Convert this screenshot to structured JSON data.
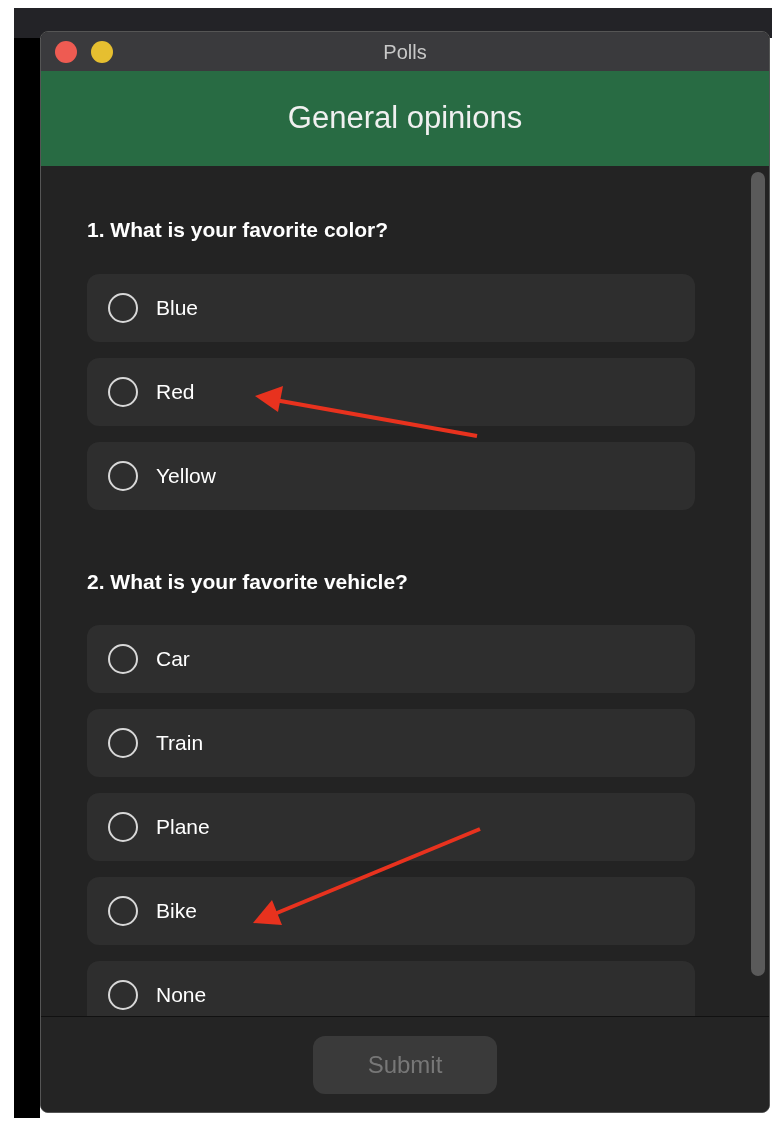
{
  "window": {
    "title": "Polls"
  },
  "header": {
    "title": "General opinions"
  },
  "questions": [
    {
      "text": "1. What is your favorite color?",
      "options": [
        {
          "label": "Blue",
          "selected": false
        },
        {
          "label": "Red",
          "selected": false
        },
        {
          "label": "Yellow",
          "selected": false
        }
      ]
    },
    {
      "text": "2. What is your favorite vehicle?",
      "options": [
        {
          "label": "Car",
          "selected": false
        },
        {
          "label": "Train",
          "selected": false
        },
        {
          "label": "Plane",
          "selected": false
        },
        {
          "label": "Bike",
          "selected": false
        },
        {
          "label": "None",
          "selected": false
        }
      ]
    }
  ],
  "submit": {
    "label": "Submit",
    "disabled": true
  }
}
